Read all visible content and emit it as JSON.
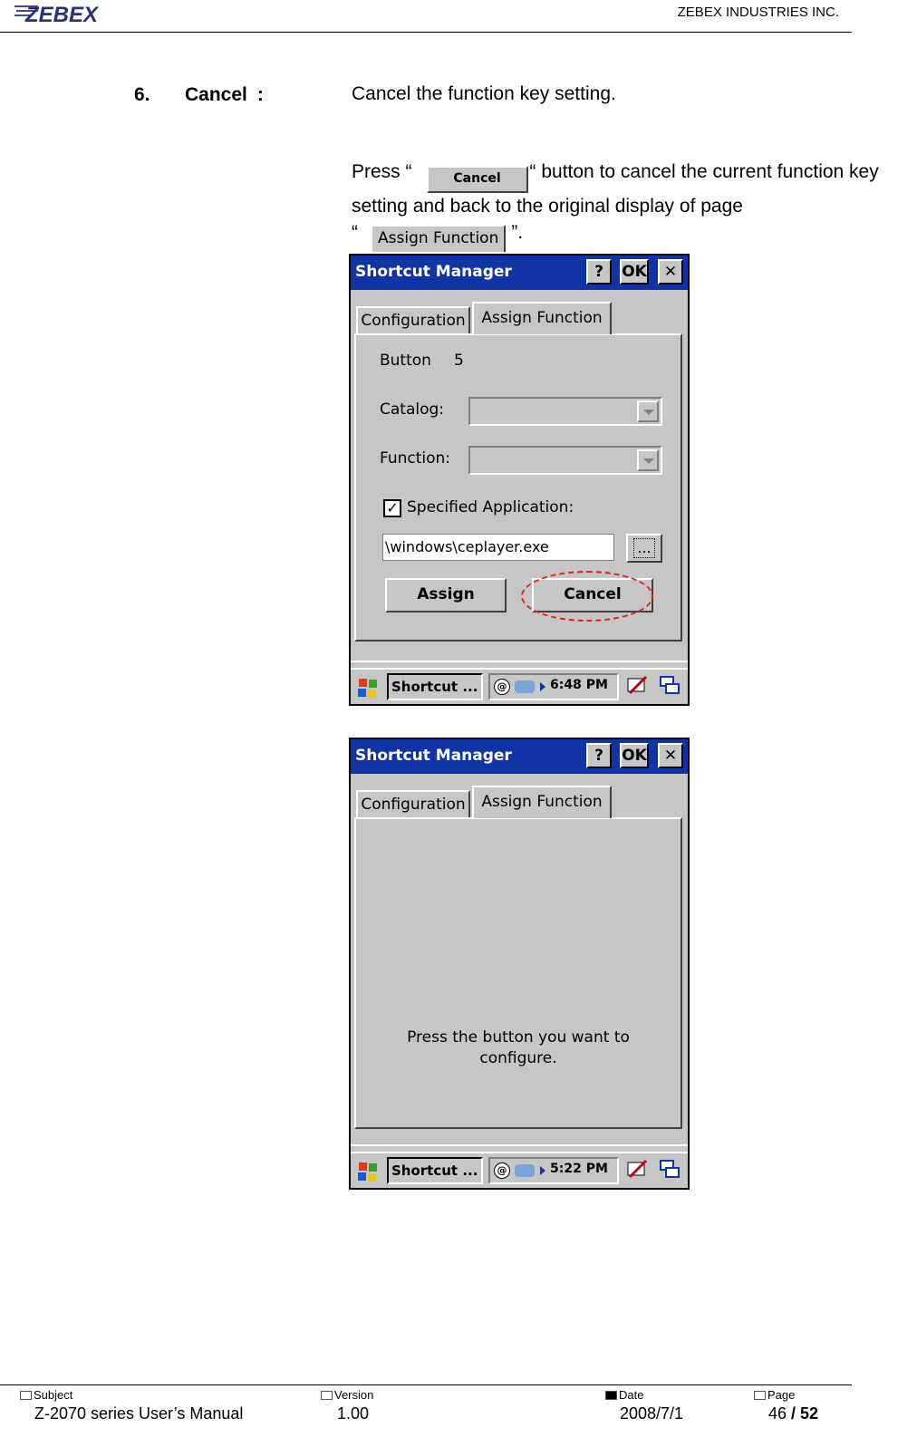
{
  "header": {
    "logo_text": "ZEBEX",
    "company": "ZEBEX INDUSTRIES INC."
  },
  "section": {
    "number": "6.",
    "title": "Cancel",
    "colon": ":",
    "description": "Cancel the function key setting."
  },
  "paragraph": {
    "press": "Press “",
    "cancel_button": "Cancel",
    "after_button": "“ button to cancel the current function key setting and back to the original display of page",
    "open_quote": "“",
    "assign_tab": "Assign Function",
    "close_quote": "”."
  },
  "screen1": {
    "title": "Shortcut Manager",
    "help": "?",
    "ok": "OK",
    "close": "✕",
    "tab_config": "Configuration",
    "tab_assign": "Assign Function",
    "button_label": "Button",
    "button_value": "5",
    "catalog_label": "Catalog:",
    "function_label": "Function:",
    "specified_app_label": "Specified Application:",
    "specified_app_checked": "✓",
    "path": "\\windows\\ceplayer.exe",
    "browse": "...",
    "assign_btn": "Assign",
    "cancel_btn": "Cancel",
    "taskbar_app": "Shortcut ...",
    "time": "6:48 PM",
    "highlight_color": "#e2231a"
  },
  "screen2": {
    "title": "Shortcut Manager",
    "help": "?",
    "ok": "OK",
    "close": "✕",
    "tab_config": "Configuration",
    "tab_assign": "Assign Function",
    "message_line1": "Press the button you want to",
    "message_line2": "configure.",
    "taskbar_app": "Shortcut ...",
    "time": "5:22 PM"
  },
  "footer": {
    "subject_label": "Subject",
    "subject": "Z-2070 series User’s Manual",
    "version_label": "Version",
    "version": "1.00",
    "date_label": "Date",
    "date": "2008/7/1",
    "page_label": "Page",
    "page_current": "46",
    "page_sep": " / ",
    "page_total": "52"
  }
}
